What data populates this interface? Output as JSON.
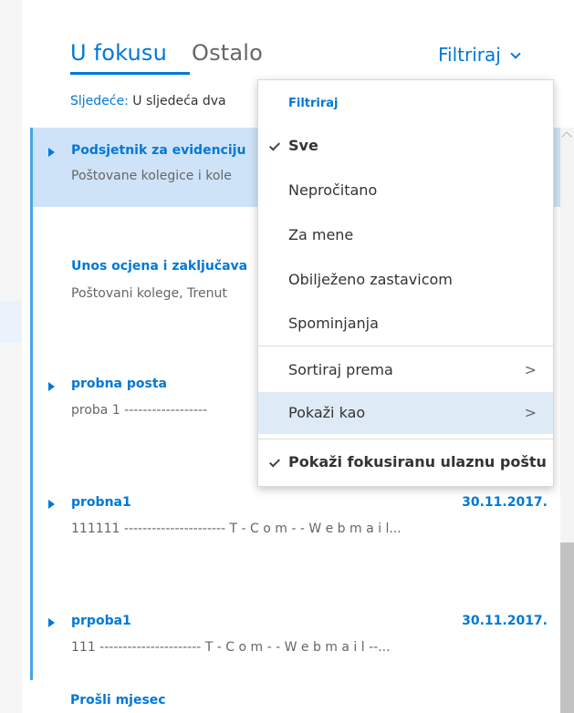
{
  "tabs": {
    "focused": "U fokusu",
    "other": "Ostalo"
  },
  "filter_button": {
    "label": "Filtriraj"
  },
  "next_event": {
    "label": "Sljedeće:",
    "text": "U sljedeća dva"
  },
  "messages": [
    {
      "subject": "Podsjetnik za evidenciju",
      "preview": "Poštovane kolegice i kole",
      "date": ""
    },
    {
      "subject": "Unos ocjena i zaključava",
      "preview": "Poštovani kolege, Trenut",
      "date": ""
    },
    {
      "subject": "probna posta",
      "preview": "proba 1 ------------------",
      "date": ""
    },
    {
      "subject": "probna1",
      "preview": "111111 ---------------------- T - C o m - - W e b m a i l...",
      "date": "30.11.2017."
    },
    {
      "subject": "prpoba1",
      "preview": "111 ---------------------- T - C o m - - W e b m a i l --...",
      "date": "30.11.2017."
    }
  ],
  "section_header": "Prošli mjesec",
  "filter_menu": {
    "header": "Filtriraj",
    "items": [
      "Sve",
      "Nepročitano",
      "Za mene",
      "Obilježeno zastavicom",
      "Spominjanja"
    ],
    "sort_by": "Sortiraj prema",
    "show_as": "Pokaži kao",
    "show_focused": "Pokaži fokusiranu ulaznu poštu"
  },
  "colors": {
    "accent": "#0078d7",
    "selected_bg": "#cfe3f8",
    "hover_bg": "#deebf6"
  }
}
